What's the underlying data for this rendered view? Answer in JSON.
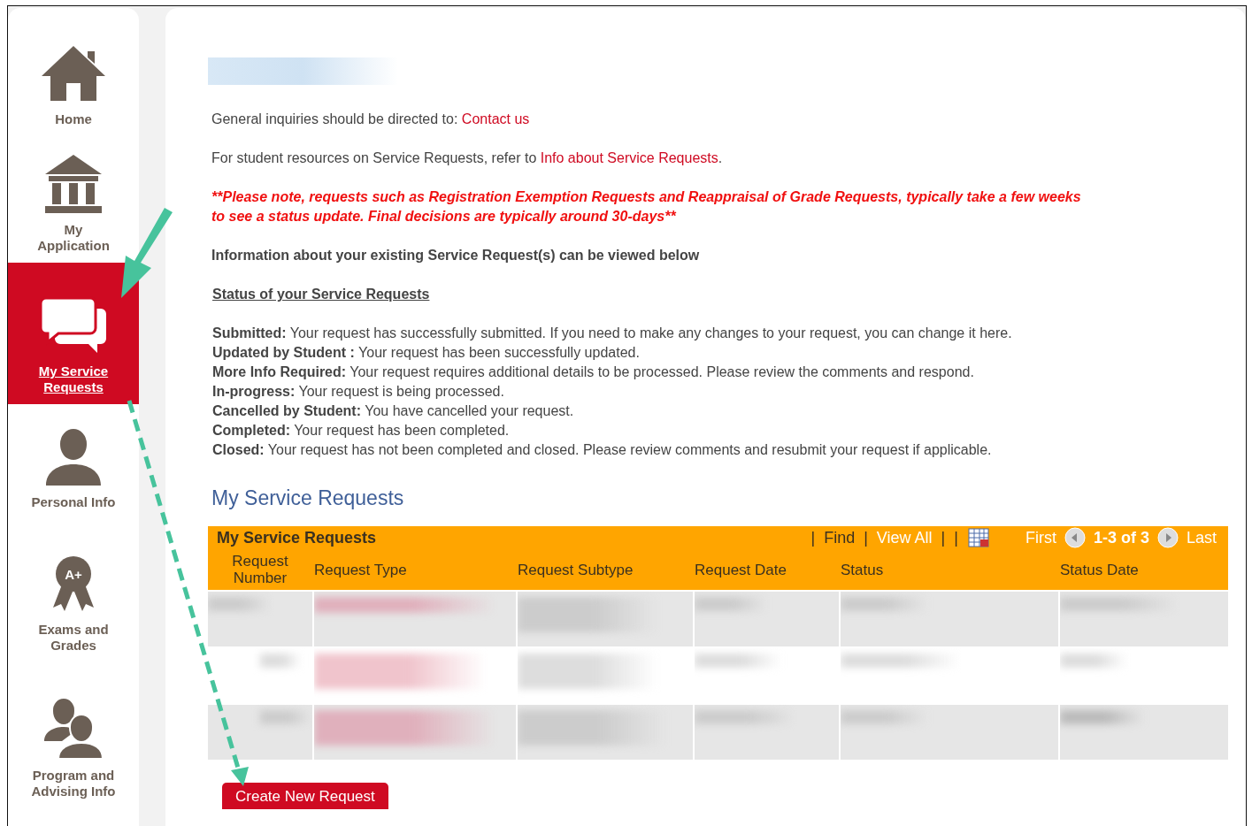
{
  "sidebar": {
    "items": [
      {
        "label": "Home",
        "kind": "home",
        "selected": false
      },
      {
        "label": "My Application",
        "kind": "building",
        "selected": false
      },
      {
        "label": "My Service Requests",
        "kind": "chat",
        "selected": true
      },
      {
        "label": "Personal Info",
        "kind": "person",
        "selected": false
      },
      {
        "label": "Exams and Grades",
        "kind": "award",
        "badge": "A+",
        "selected": false
      },
      {
        "label": "Program and Advising Info",
        "kind": "people",
        "selected": false
      }
    ]
  },
  "intro": {
    "inquiry_text": "General inquiries should be directed to: ",
    "inquiry_link": "Contact us",
    "resources_text": "For student resources on Service Requests, refer to ",
    "resources_link": "Info about Service Requests",
    "resources_end": ".",
    "note": "**Please note, requests such as Registration Exemption Requests and Reappraisal of Grade Requests, typically take a few weeks to see a status update. Final decisions are typically around 30-days**",
    "info": "Information about your existing Service Request(s) can be viewed below",
    "status_heading": "Status of your Service Requests"
  },
  "statuses": [
    "**Submitted:** Your request has successfully submitted. If you need to make any changes to your request, you can change it here.",
    "**Updated by Student :** Your request has been successfully updated.",
    "**More Info Required:** Your request requires additional details to be processed. Please review the comments and respond.",
    "**In-progress:** Your request is being processed.",
    "**Cancelled by Student:** You have cancelled your request.",
    "**Completed:** Your request has been completed.",
    "**Closed:** Your request has not been completed and closed. Please review comments and resubmit your request if applicable."
  ],
  "section_title": "My Service Requests",
  "table": {
    "title": "My Service Requests",
    "toolbar": {
      "sep1": "|",
      "find": "Find",
      "sep2": "|",
      "view_all": "View All",
      "sep3": "|",
      "sep4": "|",
      "first": "First",
      "range": "1-3 of 3",
      "last": "Last"
    },
    "columns": [
      "Request Number",
      "Request Type",
      "Request Subtype",
      "Request Date",
      "Status",
      "Status Date"
    ],
    "rows": [
      {
        "striped": true
      },
      {
        "striped": false
      },
      {
        "striped": true
      }
    ]
  },
  "create_button": "Create New Request"
}
